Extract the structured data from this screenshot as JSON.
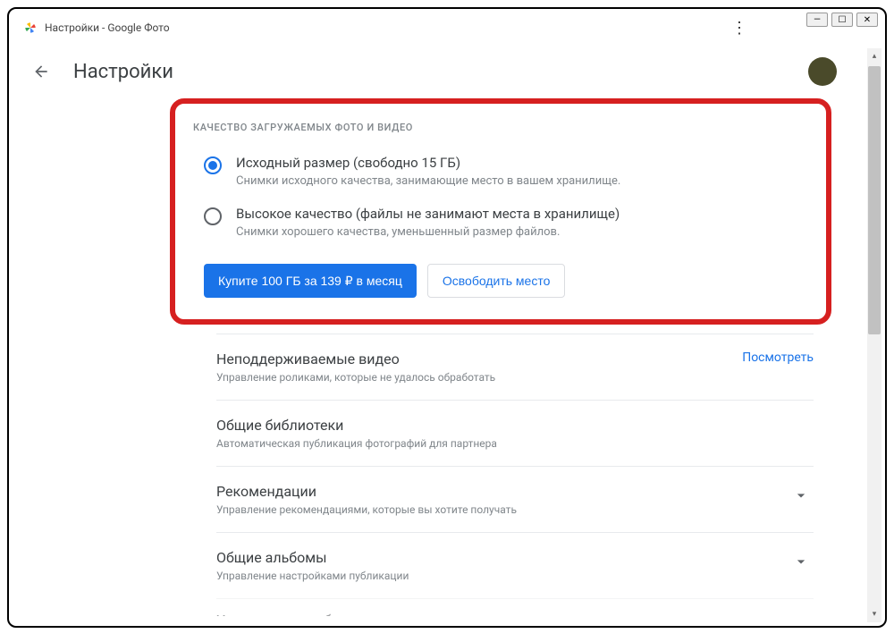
{
  "window": {
    "title": "Настройки - Google Фото"
  },
  "header": {
    "title": "Настройки"
  },
  "quality": {
    "header": "КАЧЕСТВО ЗАГРУЖАЕМЫХ ФОТО И ВИДЕО",
    "options": [
      {
        "title": "Исходный размер (свободно 15 ГБ)",
        "desc": "Снимки исходного качества, занимающие место в вашем хранилище."
      },
      {
        "title": "Высокое качество (файлы не занимают места в хранилище)",
        "desc": "Снимки хорошего качества, уменьшенный размер файлов."
      }
    ],
    "buy_button": "Купите 100 ГБ за 139 ₽ в месяц",
    "free_button": "Освободить место"
  },
  "settings": [
    {
      "title": "Неподдерживаемые видео",
      "desc": "Управление роликами, которые не удалось обработать",
      "action": "Посмотреть",
      "type": "link"
    },
    {
      "title": "Общие библиотеки",
      "desc": "Автоматическая публикация фотографий для партнера",
      "type": "none"
    },
    {
      "title": "Рекомендации",
      "desc": "Управление рекомендациями, которые вы хотите получать",
      "type": "expand"
    },
    {
      "title": "Общие альбомы",
      "desc": "Управление настройками публикации",
      "type": "expand"
    }
  ],
  "cutoff": "Уведомления в браузере"
}
